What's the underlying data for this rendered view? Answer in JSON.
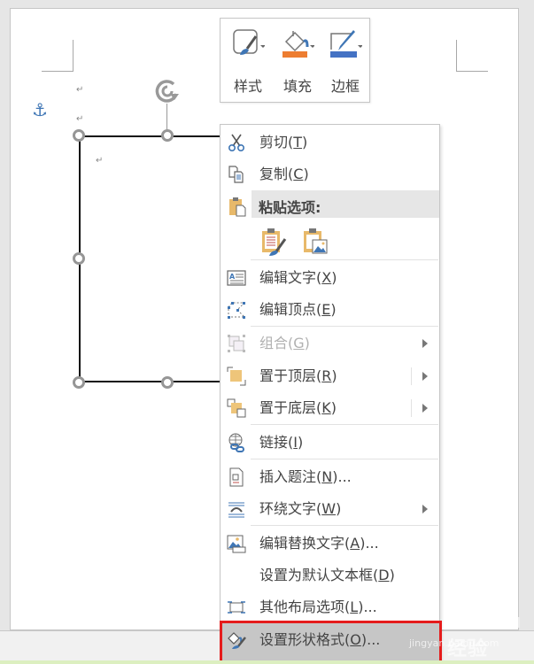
{
  "minibar": {
    "buttons": [
      {
        "label": "样式",
        "icon": "shape-style-icon"
      },
      {
        "label": "填充",
        "icon": "fill-bucket-icon",
        "color": "#ed7d31"
      },
      {
        "label": "边框",
        "icon": "outline-pen-icon",
        "color": "#4472c4"
      }
    ]
  },
  "document": {
    "paragraph_mark": "↵",
    "anchor_icon": "⚓"
  },
  "context_menu": {
    "items": [
      {
        "label": "剪切",
        "key": "T",
        "icon": "scissors-icon"
      },
      {
        "label": "复制",
        "key": "C",
        "icon": "copy-icon"
      },
      {
        "label": "粘贴选项:",
        "icon": "paste-icon"
      },
      {
        "label": "编辑文字",
        "key": "X",
        "icon": "edit-text-icon"
      },
      {
        "label": "编辑顶点",
        "key": "E",
        "icon": "edit-points-icon"
      },
      {
        "label": "组合",
        "key": "G",
        "icon": "group-icon",
        "disabled": true,
        "submenu": true
      },
      {
        "label": "置于顶层",
        "key": "R",
        "icon": "bring-to-front-icon",
        "submenu": true
      },
      {
        "label": "置于底层",
        "key": "K",
        "icon": "send-to-back-icon",
        "submenu": true
      },
      {
        "label": "链接",
        "key": "I",
        "icon": "link-icon"
      },
      {
        "label": "插入题注",
        "key": "N",
        "suffix": "...",
        "icon": "insert-caption-icon"
      },
      {
        "label": "环绕文字",
        "key": "W",
        "icon": "wrap-text-icon",
        "submenu": true
      },
      {
        "label": "编辑替换文字",
        "key": "A",
        "suffix": "...",
        "icon": "alt-text-icon"
      },
      {
        "label": "设置为默认文本框",
        "key": "D"
      },
      {
        "label": "其他布局选项",
        "key": "L",
        "suffix": "...",
        "icon": "layout-options-icon"
      },
      {
        "label": "设置形状格式",
        "key": "O",
        "suffix": "...",
        "icon": "format-shape-icon",
        "highlighted": true
      }
    ],
    "paste_options": [
      "keep-source-formatting-icon",
      "paste-as-picture-icon"
    ]
  },
  "watermark": {
    "brand": "Bai du 经验",
    "url": "jingyan.baidu.com"
  },
  "colors": {
    "highlight_border": "#e51c1c",
    "accent_blue": "#3f76b5"
  }
}
